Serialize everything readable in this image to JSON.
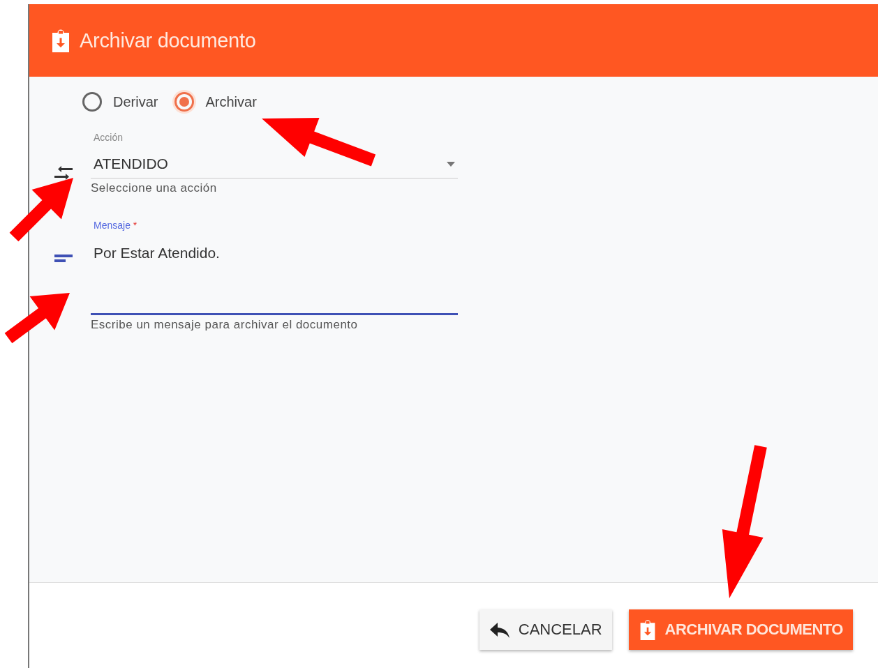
{
  "dialog": {
    "title": "Archivar documento"
  },
  "mode_options": [
    {
      "label": "Derivar",
      "selected": false
    },
    {
      "label": "Archivar",
      "selected": true
    }
  ],
  "action_field": {
    "label": "Acción",
    "value": "ATENDIDO",
    "hint": "Seleccione una acción"
  },
  "message_field": {
    "label": "Mensaje",
    "required_mark": "*",
    "value": "Por Estar Atendido.",
    "hint": "Escribe un mensaje para archivar el documento",
    "focused": true
  },
  "buttons": [
    {
      "label": "CANCELAR",
      "kind": "cancel"
    },
    {
      "label": "ARCHIVAR DOCUMENTO",
      "kind": "primary"
    }
  ]
}
